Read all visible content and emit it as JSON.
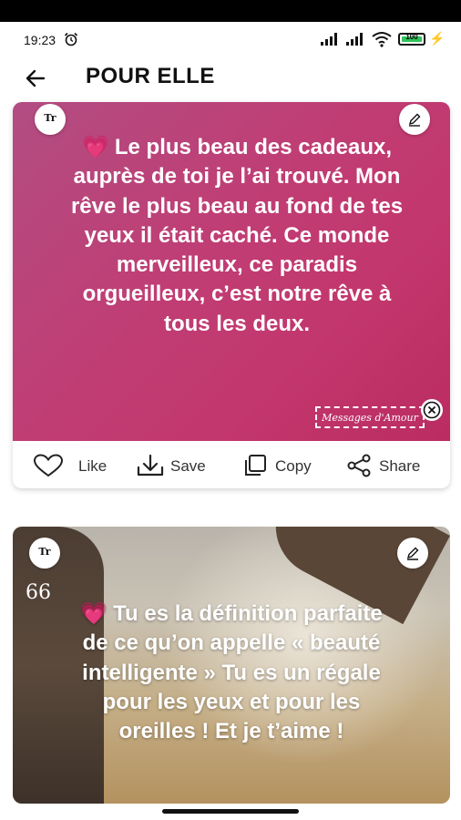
{
  "status_bar": {
    "time": "19:23",
    "battery": "100"
  },
  "app_bar": {
    "title": "POUR ELLE",
    "back_icon": "arrow-left-icon"
  },
  "cards": [
    {
      "font_button": "Tr",
      "quote": "Le plus beau des cadeaux, auprès de toi je l’ai trouvé. Mon rêve le plus beau au fond de tes yeux il était caché. Ce monde merveilleux, ce paradis orgueilleux, c’est notre rêve à tous les deux.",
      "heart": "💗",
      "watermark": "Messages d'Amour",
      "actions": {
        "like": "Like",
        "save": "Save",
        "copy": "Copy",
        "share": "Share"
      },
      "colors": {
        "background_start": "#b24d82",
        "background_end": "#ba2c62"
      }
    },
    {
      "font_button": "Tr",
      "quote_mark": "66",
      "quote": "Tu es la définition parfaite de ce qu’on appelle « beauté intelligente » Tu es un régale pour les yeux et pour les oreilles ! Et je t’aime !",
      "heart": "💗"
    }
  ]
}
